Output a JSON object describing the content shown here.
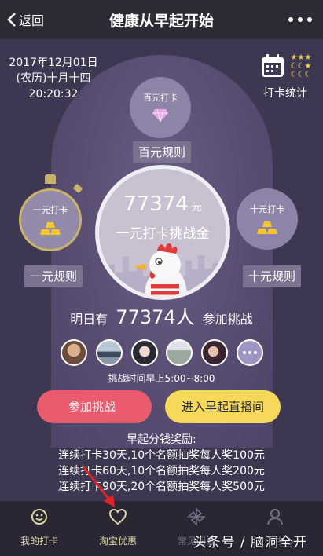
{
  "navbar": {
    "back_label": "返回",
    "title": "健康从早起开始"
  },
  "header": {
    "date": "2017年12月01日",
    "lunar": "(农历)十月十四",
    "time": "20:20:32",
    "stats_label": "打卡统计"
  },
  "medals": {
    "hundred": {
      "label": "百元打卡",
      "rule": "百元规则"
    },
    "one": {
      "label": "一元打卡",
      "rule": "一元规则"
    },
    "ten": {
      "label": "十元打卡",
      "rule": "十元规则"
    }
  },
  "pool": {
    "amount": "77374",
    "unit": "元",
    "label": "一元打卡挑战金"
  },
  "tomorrow": {
    "prefix": "明日有",
    "count": "77374人",
    "suffix": "参加挑战"
  },
  "challenge_time": "挑战时间早上5:00~8:00",
  "buttons": {
    "join": "参加挑战",
    "live": "进入早起直播间"
  },
  "rewards": {
    "title": "早起分钱奖励:",
    "lines": [
      "连续打卡30天,10个名额抽奖每人奖100元",
      "连续打卡60天,10个名额抽奖每人奖200元",
      "连续打卡90天,20个名额抽奖每人奖500元"
    ]
  },
  "tabs": [
    {
      "label": "我的打卡",
      "icon": "smile-icon"
    },
    {
      "label": "淘宝优惠",
      "icon": "heart-icon"
    },
    {
      "label": "常见问题",
      "icon": "pinwheel-icon"
    },
    {
      "label": "个人中心",
      "icon": "person-icon"
    }
  ],
  "watermark": "头条号 / 脑洞全开",
  "colors": {
    "background": "#3d3751",
    "arch": "#5a4f73",
    "join_button": "#ea5b6d",
    "live_button": "#f6d95a",
    "tab_active": "#ded8a8",
    "arrow": "#e2232a"
  }
}
